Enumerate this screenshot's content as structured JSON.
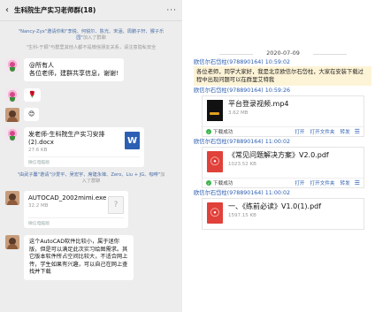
{
  "mobile": {
    "title": "生科院生产实习老师群(18)",
    "system1": {
      "hl": "\"Nancy-Zyx\"邀请你和\"李锐、何锐尔、陈光、宋涵、周鹏子轩、猴子乐园\"",
      "tail": "加入了群聊"
    },
    "system2": "\"生科-于颖\"与群里其他人都不是微信朋友关系，请注意隐私安全",
    "msg1": {
      "line1": "@所有人",
      "line2": "各位老师，建群共享信息，谢谢!"
    },
    "msg2": "🌹",
    "msg3": "😊",
    "file1": {
      "name": "发老师-生科院生产实习安排(2).docx",
      "size": "27.6 KB",
      "footer": "微信电脑版",
      "icon_letter": "W"
    },
    "system3": {
      "hl": "\"由武子馨\"邀请\"沙爱平、吴宏宇、席建永锋、Zero、Liu + JG、咖啡\"",
      "tail": "加入了群聊"
    },
    "file2": {
      "name": "AUTOCAD_2002mimi.exe",
      "size": "32.2 MB",
      "footer": "微信电脑版",
      "icon_letter": "?"
    },
    "msg4": "这个AutoCAD软件比较小，属于迷你版，但是可以满足此次实习绘图需求。其它版本软件所占空间比较大，不适合网上传，学生如果有兴趣，可以自己在网上查找并下载"
  },
  "pc": {
    "date": "2020-07-09",
    "sender1": "欧信尔石岱柱(978890164) 10:59:02",
    "announce": "各位老师，同学大家好，我是北京欧信尔石岱柱，大家在安装下载过程中出现问题可以在群里艾特我",
    "sender2": "欧信尔石岱柱(978890164) 10:59:26",
    "file1": {
      "name": "平台登录视频.mp4",
      "size": "3.62 MB"
    },
    "sender3": "欧信尔石岱柱(978890164) 11:00:02",
    "file2": {
      "name": "《常见问题解决方案》V2.0.pdf",
      "size": "1023.52 KB"
    },
    "sender4": "欧信尔石岱柱(978890164) 11:00:02",
    "file3": {
      "name": "一、《练前必读》V1.0(1).pdf",
      "size": "1597.15 KB"
    },
    "actions": {
      "status": "下载成功",
      "open": "打开",
      "open_folder": "打开文件夹",
      "forward": "转发"
    }
  }
}
